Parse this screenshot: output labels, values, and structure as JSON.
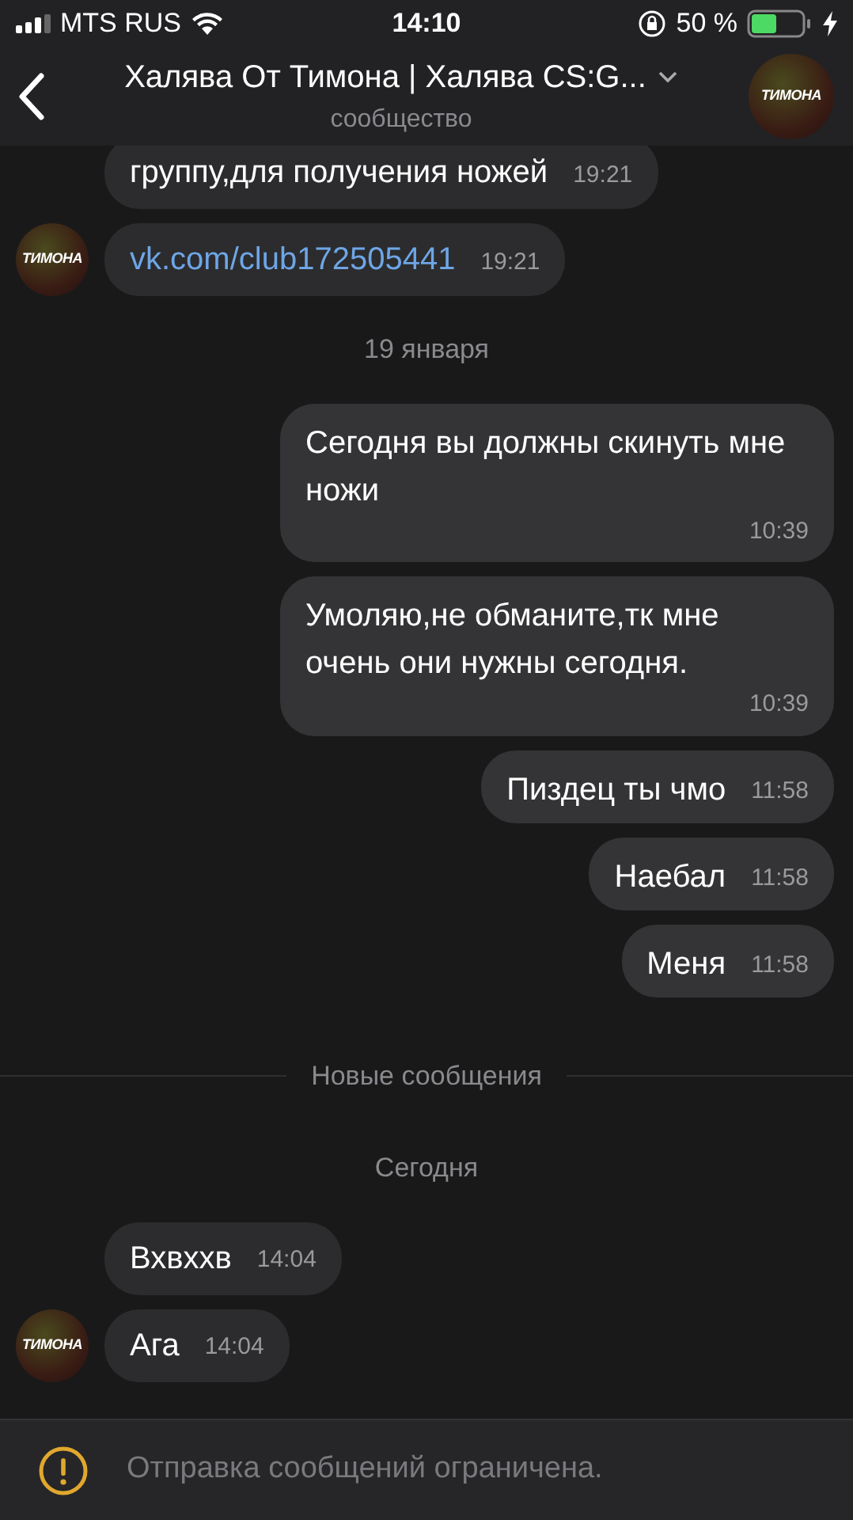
{
  "status_bar": {
    "carrier": "MTS RUS",
    "time": "14:10",
    "battery": "50 %"
  },
  "header": {
    "title": "Халява От Тимона | Халява CS:G...",
    "subtitle": "сообщество",
    "avatar_text": "ТИМОНА"
  },
  "messages": [
    {
      "kind": "incoming",
      "text": "группу,для получения ножей",
      "time": "19:21",
      "avatar": false,
      "link": false
    },
    {
      "kind": "incoming",
      "text": "vk.com/club172505441",
      "time": "19:21",
      "avatar": true,
      "avatar_text": "ТИМОНА",
      "link": true
    },
    {
      "kind": "date",
      "text": "19 января"
    },
    {
      "kind": "outgoing",
      "text": "Сегодня вы должны скинуть мне ножи",
      "time": "10:39"
    },
    {
      "kind": "outgoing",
      "text": "Умоляю,не обманите,тк мне очень они нужны сегодня.",
      "time": "10:39"
    },
    {
      "kind": "outgoing",
      "text": "Пиздец ты чмо",
      "time": "11:58"
    },
    {
      "kind": "outgoing",
      "text": "Наебал",
      "time": "11:58"
    },
    {
      "kind": "outgoing",
      "text": "Меня",
      "time": "11:58"
    },
    {
      "kind": "divider",
      "text": "Новые сообщения"
    },
    {
      "kind": "date",
      "text": "Сегодня"
    },
    {
      "kind": "incoming",
      "text": "Вхвххв",
      "time": "14:04",
      "avatar": false,
      "link": false
    },
    {
      "kind": "incoming",
      "text": "Ага",
      "time": "14:04",
      "avatar": true,
      "avatar_text": "ТИМОНА",
      "link": false
    }
  ],
  "footer": {
    "notice": "Отправка сообщений ограничена."
  }
}
